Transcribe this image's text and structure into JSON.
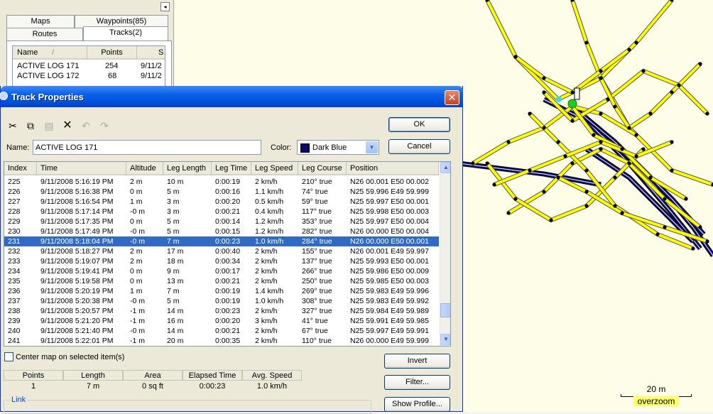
{
  "left_panel": {
    "collapse_glyph": "◂",
    "tabs": [
      {
        "label": "Maps",
        "active": false
      },
      {
        "label": "Waypoints(85)",
        "active": false
      },
      {
        "label": "Routes",
        "active": false
      },
      {
        "label": "Tracks(2)",
        "active": true
      }
    ],
    "track_list": {
      "columns": [
        "Name",
        "Points",
        "S"
      ],
      "rows": [
        {
          "name": "ACTIVE LOG 171",
          "points": "254",
          "date": "9/11/2"
        },
        {
          "name": "ACTIVE LOG 172",
          "points": "68",
          "date": "9/11/2"
        }
      ]
    }
  },
  "dialog": {
    "title": "Track Properties",
    "close_glyph": "✕",
    "toolbar": {
      "cut_glyph": "✂",
      "copy_glyph": "⧉",
      "paste_glyph": "▤",
      "delete_glyph": "✕",
      "undo_glyph": "↶",
      "redo_glyph": "↷"
    },
    "ok_label": "OK",
    "cancel_label": "Cancel",
    "name_label": "Name:",
    "name_value": "ACTIVE LOG 171",
    "color_label": "Color:",
    "color_value": "Dark Blue",
    "color_swatch": "#0a0a6e",
    "grid": {
      "columns": [
        "Index",
        "Time",
        "Altitude",
        "Leg Length",
        "Leg Time",
        "Leg Speed",
        "Leg Course",
        "Position"
      ],
      "selected_index": "231",
      "rows": [
        [
          "225",
          "9/11/2008 5:16:19 PM",
          "2 m",
          "10 m",
          "0:00:19",
          "2 km/h",
          "210° true",
          "N26 00.001 E50 00.002"
        ],
        [
          "226",
          "9/11/2008 5:16:38 PM",
          "0 m",
          "5 m",
          "0:00:16",
          "1.1 km/h",
          "74° true",
          "N25 59.996 E49 59.999"
        ],
        [
          "227",
          "9/11/2008 5:16:54 PM",
          "1 m",
          "3 m",
          "0:00:20",
          "0.5 km/h",
          "59° true",
          "N25 59.997 E50 00.001"
        ],
        [
          "228",
          "9/11/2008 5:17:14 PM",
          "-0 m",
          "3 m",
          "0:00:21",
          "0.4 km/h",
          "117° true",
          "N25 59.998 E50 00.003"
        ],
        [
          "229",
          "9/11/2008 5:17:35 PM",
          "0 m",
          "5 m",
          "0:00:14",
          "1.2 km/h",
          "353° true",
          "N25 59.997 E50 00.004"
        ],
        [
          "230",
          "9/11/2008 5:17:49 PM",
          "-0 m",
          "5 m",
          "0:00:15",
          "1.2 km/h",
          "282° true",
          "N26 00.000 E50 00.004"
        ],
        [
          "231",
          "9/11/2008 5:18:04 PM",
          "-0 m",
          "7 m",
          "0:00:23",
          "1.0 km/h",
          "284° true",
          "N26 00.000 E50 00.001"
        ],
        [
          "232",
          "9/11/2008 5:18:27 PM",
          "2 m",
          "17 m",
          "0:00:40",
          "2 km/h",
          "155° true",
          "N26 00.001 E49 59.997"
        ],
        [
          "233",
          "9/11/2008 5:19:07 PM",
          "2 m",
          "18 m",
          "0:00:34",
          "2 km/h",
          "137° true",
          "N25 59.993 E50 00.001"
        ],
        [
          "234",
          "9/11/2008 5:19:41 PM",
          "0 m",
          "9 m",
          "0:00:17",
          "2 km/h",
          "266° true",
          "N25 59.986 E50 00.009"
        ],
        [
          "235",
          "9/11/2008 5:19:58 PM",
          "0 m",
          "13 m",
          "0:00:21",
          "2 km/h",
          "250° true",
          "N25 59.985 E50 00.003"
        ],
        [
          "236",
          "9/11/2008 5:20:19 PM",
          "1 m",
          "7 m",
          "0:00:19",
          "1.4 km/h",
          "269° true",
          "N25 59.983 E49 59.996"
        ],
        [
          "237",
          "9/11/2008 5:20:38 PM",
          "-0 m",
          "5 m",
          "0:00:19",
          "1.0 km/h",
          "308° true",
          "N25 59.983 E49 59.992"
        ],
        [
          "238",
          "9/11/2008 5:20:57 PM",
          "-1 m",
          "14 m",
          "0:00:23",
          "2 km/h",
          "327° true",
          "N25 59.984 E49 59.989"
        ],
        [
          "239",
          "9/11/2008 5:21:20 PM",
          "-1 m",
          "16 m",
          "0:00:20",
          "3 km/h",
          "41° true",
          "N25 59.991 E49 59.985"
        ],
        [
          "240",
          "9/11/2008 5:21:40 PM",
          "-0 m",
          "14 m",
          "0:00:21",
          "2 km/h",
          "67° true",
          "N25 59.997 E49 59.991"
        ],
        [
          "241",
          "9/11/2008 5:22:01 PM",
          "-1 m",
          "20 m",
          "0:00:35",
          "2 km/h",
          "110° true",
          "N26 00.000 E49 59.999"
        ]
      ]
    },
    "scroll_up_glyph": "▲",
    "scroll_down_glyph": "▼",
    "center_map_label": "Center map on selected item(s)",
    "center_map_checked": false,
    "stats": {
      "headers": [
        "Points",
        "Length",
        "Area",
        "Elapsed Time",
        "Avg. Speed"
      ],
      "values": [
        "1",
        "7 m",
        "0 sq ft",
        "0:00:23",
        "1.0 km/h"
      ]
    },
    "invert_label": "Invert",
    "filter_label": "Filter...",
    "show_profile_label": "Show Profile...",
    "link_label": "Link"
  },
  "map": {
    "scale_label": "20 m",
    "overzoom_label": "overzoom",
    "track_color_yellow": "#ffff00",
    "track_color_blue": "#0a0a6e"
  }
}
